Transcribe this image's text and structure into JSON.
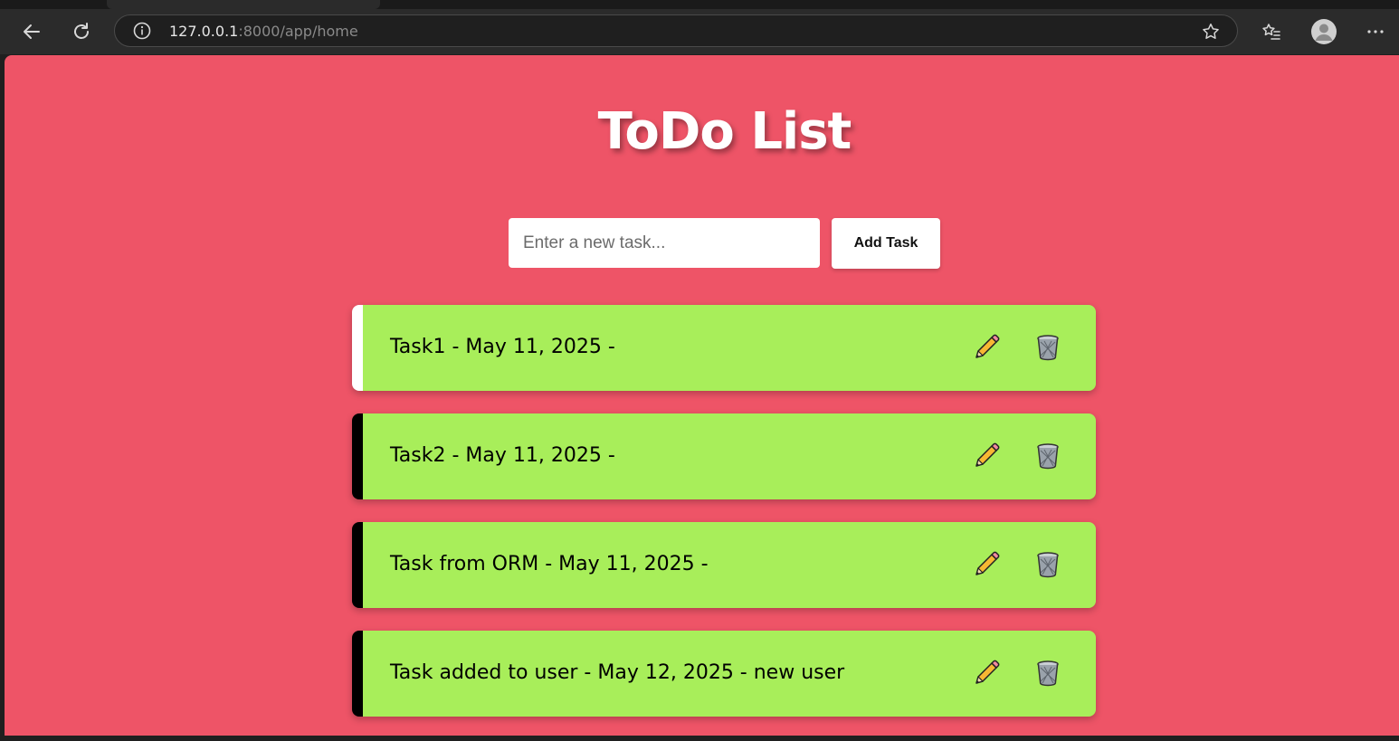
{
  "browser": {
    "url_host": "127.0.0.1",
    "url_rest": ":8000/app/home",
    "icons": [
      "back-icon",
      "refresh-icon",
      "site-info-icon",
      "favorite-star-icon",
      "favorites-list-icon",
      "profile-avatar-icon",
      "more-menu-icon"
    ]
  },
  "page": {
    "title": "ToDo List",
    "background_color": "#ee5467",
    "input_placeholder": "Enter a new task...",
    "add_button_label": "Add Task"
  },
  "tasks": [
    {
      "text": "Task1 - May 11, 2025 -",
      "border_color": "#ffffff"
    },
    {
      "text": "Task2 - May 11, 2025 -",
      "border_color": "#000000"
    },
    {
      "text": "Task from ORM - May 11, 2025 -",
      "border_color": "#000000"
    },
    {
      "text": "Task added to user - May 12, 2025 - new user",
      "border_color": "#000000"
    }
  ],
  "task_colors": {
    "card": "#a8ee5a"
  },
  "task_action_icons": [
    "pencil-icon",
    "trash-can-icon"
  ]
}
